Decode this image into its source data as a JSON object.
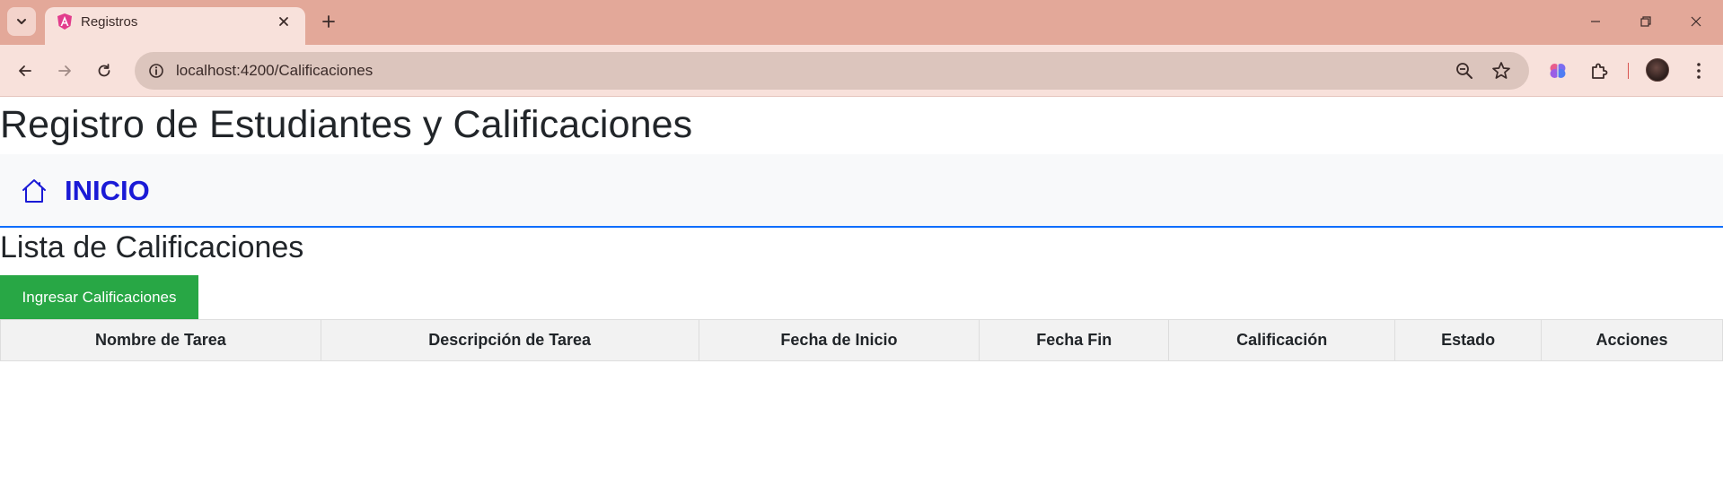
{
  "browser": {
    "tab_title": "Registros",
    "url": "localhost:4200/Calificaciones",
    "icons": {
      "tab_menu": "chevron-down-icon",
      "favicon": "angular-icon",
      "tab_close": "close-icon",
      "new_tab": "plus-icon",
      "back": "arrow-left-icon",
      "forward": "arrow-right-icon",
      "reload": "reload-icon",
      "site_info": "info-icon",
      "zoom": "zoom-out-icon",
      "bookmark": "star-icon",
      "extension_1": "brain-icon",
      "extensions": "puzzle-icon",
      "menu": "kebab-icon"
    }
  },
  "page": {
    "title": "Registro de Estudiantes y Calificaciones",
    "nav": {
      "home_label": "INICIO",
      "home_icon": "home-icon"
    },
    "section_title": "Lista de Calificaciones",
    "add_button_label": "Ingresar Calificaciones",
    "table": {
      "columns": [
        "Nombre de Tarea",
        "Descripción de Tarea",
        "Fecha de Inicio",
        "Fecha Fin",
        "Calificación",
        "Estado",
        "Acciones"
      ],
      "rows": []
    }
  },
  "colors": {
    "accent_success": "#28a745",
    "nav_link": "#1a1ad6",
    "nav_border": "#0d6efd",
    "table_header_bg": "#f2f2f2",
    "tabstrip_bg": "#e3a899"
  }
}
